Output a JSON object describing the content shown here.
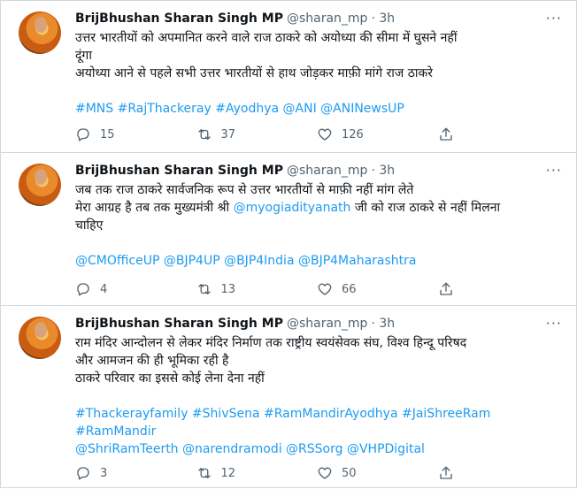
{
  "tweets": [
    {
      "name": "BrijBhushan Sharan Singh MP",
      "handle": "@sharan_mp",
      "time": "· 3h",
      "lines": [
        "उत्तर भारतीयों को अपमानित करने वाले राज ठाकरे को अयोध्या की सीमा में घुसने नहीं",
        "दूंगा",
        "अयोध्या आने से पहले सभी उत्तर भारतीयों से हाथ जोड़कर माफ़ी मांगे राज ठाकरे"
      ],
      "links": [
        "#MNS #RajThackeray #Ayodhya @ANI @ANINewsUP"
      ],
      "reply_count": "15",
      "retweet_count": "37",
      "like_count": "126"
    },
    {
      "name": "BrijBhushan Sharan Singh MP",
      "handle": "@sharan_mp",
      "time": "· 3h",
      "line1": "जब तक राज ठाकरे सार्वजनिक रूप से उत्तर भारतीयों से माफ़ी नहीं मांग लेते",
      "line2_prefix": "मेरा आग्रह है तब तक मुख्यमंत्री श्री ",
      "line2_mention": "@myogiadityanath",
      "line2_suffix": " जी को राज ठाकरे से नहीं मिलना",
      "line3": "चाहिए",
      "links": [
        "@CMOfficeUP @BJP4UP @BJP4India @BJP4Maharashtra"
      ],
      "reply_count": "4",
      "retweet_count": "13",
      "like_count": "66"
    },
    {
      "name": "BrijBhushan Sharan Singh MP",
      "handle": "@sharan_mp",
      "time": "· 3h",
      "lines": [
        "राम मंदिर आन्दोलन से लेकर मंदिर निर्माण तक राष्ट्रीय स्वयंसेवक संघ, विश्व हिन्दू परिषद",
        "और आमजन की ही भूमिका रही है",
        "ठाकरे परिवार का इससे कोई लेना देना नहीं"
      ],
      "links": [
        "#Thackerayfamily #ShivSena #RamMandirAyodhya #JaiShreeRam",
        "#RamMandir",
        "@ShriRamTeerth @narendramodi @RSSorg @VHPDigital"
      ],
      "reply_count": "3",
      "retweet_count": "12",
      "like_count": "50"
    }
  ],
  "icons": {
    "more": "more-options-icon",
    "reply": "reply-icon",
    "retweet": "retweet-icon",
    "like": "like-icon",
    "share": "share-icon"
  },
  "colors": {
    "link": "#1d9bf0",
    "muted": "#536471",
    "text": "#0f1419",
    "divider": "#cfd9de"
  }
}
